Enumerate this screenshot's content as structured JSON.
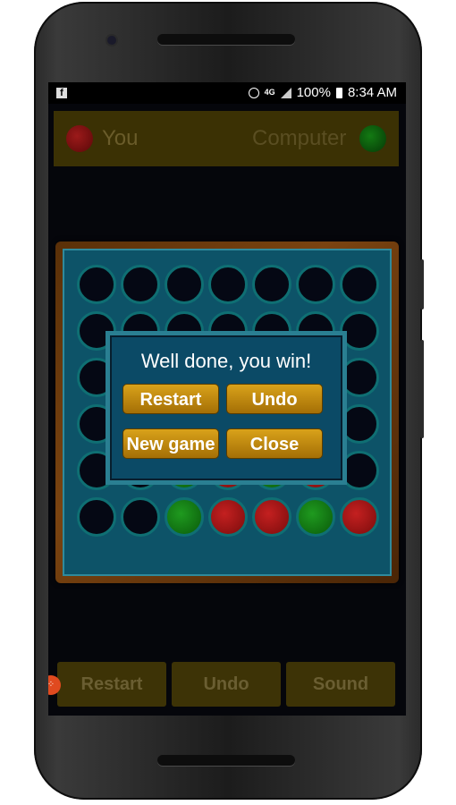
{
  "status_bar": {
    "app_icon": "facebook-icon",
    "network": "4G",
    "battery": "100%",
    "time": "8:34 AM"
  },
  "players": {
    "you": {
      "label": "You",
      "color": "#b0161c"
    },
    "computer": {
      "label": "Computer",
      "color": "#0f7a0f"
    }
  },
  "board": {
    "rows": [
      [
        "empty",
        "empty",
        "empty",
        "empty",
        "empty",
        "empty",
        "empty"
      ],
      [
        "empty",
        "empty",
        "empty",
        "empty",
        "empty",
        "empty",
        "empty"
      ],
      [
        "empty",
        "empty",
        "empty",
        "empty",
        "empty",
        "empty",
        "empty"
      ],
      [
        "empty",
        "empty",
        "empty",
        "empty",
        "empty",
        "empty",
        "empty"
      ],
      [
        "empty",
        "empty",
        "green",
        "red",
        "green",
        "red",
        "empty"
      ],
      [
        "empty",
        "empty",
        "green",
        "red",
        "red",
        "green",
        "red"
      ]
    ]
  },
  "dialog": {
    "title": "Well done, you win!",
    "restart_label": "Restart",
    "undo_label": "Undo",
    "new_game_label": "New game",
    "close_label": "Close"
  },
  "bottom_bar": {
    "restart_label": "Restart",
    "undo_label": "Undo",
    "sound_label": "Sound"
  }
}
